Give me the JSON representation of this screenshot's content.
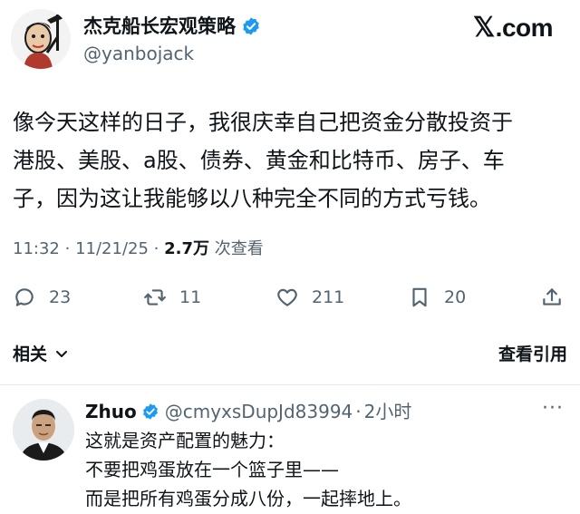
{
  "post": {
    "author": {
      "display_name": "杰克船长宏观策略",
      "handle": "@yanbojack",
      "verified": true
    },
    "source_logo": "com",
    "text_lines": [
      "像今天这样的日子，我很庆幸自己把资金分散投资于",
      "港股、美股、a股、债券、黄金和比特币、房子、车",
      "子，因为这让我能够以八种完全不同的方式亏钱。"
    ],
    "time": "11:32",
    "date": "11/21/25",
    "separator": "·",
    "views_count": "2.7万",
    "views_label": "次查看",
    "stats": {
      "replies": "23",
      "reposts": "11",
      "likes": "211",
      "bookmarks": "20"
    }
  },
  "related": {
    "label": "相关",
    "view_quotes": "查看引用"
  },
  "reply": {
    "display_name": "Zhuo",
    "verified": true,
    "handle": "@cmyxsDupJd83994",
    "separator": "·",
    "time": "2小时",
    "more_label": "···",
    "text_lines": [
      "这就是资产配置的魅力：",
      "不要把鸡蛋放在一个篮子里——",
      "而是把所有鸡蛋分成八份，一起摔地上。"
    ]
  },
  "colors": {
    "text_primary": "#0f1419",
    "text_secondary": "#536471",
    "verified_blue": "#1d9bf0",
    "divider": "#e6e9ea"
  },
  "icons": {
    "reply": "speech-bubble-icon",
    "repost": "repost-arrows-icon",
    "like": "heart-icon",
    "bookmark": "bookmark-icon",
    "share": "share-upload-icon",
    "verified": "verified-badge-icon",
    "chevron": "chevron-down-icon"
  }
}
